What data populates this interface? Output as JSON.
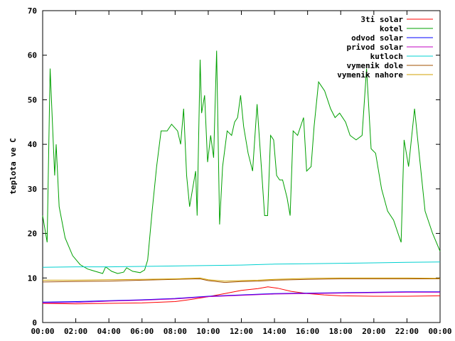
{
  "chart_data": {
    "type": "line",
    "title": "",
    "xlabel": "",
    "ylabel": "teplota ve C",
    "xlim": [
      0,
      24
    ],
    "ylim": [
      0,
      70
    ],
    "xticks": [
      "00:00",
      "02:00",
      "04:00",
      "06:00",
      "08:00",
      "10:00",
      "12:00",
      "14:00",
      "16:00",
      "18:00",
      "20:00",
      "22:00",
      "00:00"
    ],
    "yticks": [
      "0",
      "10",
      "20",
      "30",
      "40",
      "50",
      "60",
      "70"
    ],
    "grid": false,
    "legend_position": "top-right",
    "series": [
      {
        "name": "3ti solar",
        "color": "#ff0000",
        "points": [
          [
            0,
            4.3
          ],
          [
            2,
            4.2
          ],
          [
            4,
            4.3
          ],
          [
            6,
            4.4
          ],
          [
            8,
            4.7
          ],
          [
            9,
            5.2
          ],
          [
            10,
            5.8
          ],
          [
            11,
            6.5
          ],
          [
            12,
            7.2
          ],
          [
            13,
            7.6
          ],
          [
            13.6,
            8.0
          ],
          [
            14.2,
            7.7
          ],
          [
            15,
            7.0
          ],
          [
            16,
            6.5
          ],
          [
            17,
            6.2
          ],
          [
            18,
            6.0
          ],
          [
            20,
            5.9
          ],
          [
            22,
            5.9
          ],
          [
            24,
            6.0
          ]
        ]
      },
      {
        "name": "kotel",
        "color": "#00a000",
        "points": [
          [
            0,
            24
          ],
          [
            0.3,
            18
          ],
          [
            0.5,
            57
          ],
          [
            0.8,
            33
          ],
          [
            0.9,
            40
          ],
          [
            1.1,
            26
          ],
          [
            1.5,
            19
          ],
          [
            2,
            15
          ],
          [
            2.5,
            13
          ],
          [
            3,
            12
          ],
          [
            3.5,
            11.5
          ],
          [
            4,
            11
          ],
          [
            4.2,
            12.5
          ],
          [
            4.6,
            11.5
          ],
          [
            5,
            11
          ],
          [
            5.4,
            11.3
          ],
          [
            5.6,
            12.3
          ],
          [
            6,
            11.5
          ],
          [
            6.5,
            11.2
          ],
          [
            6.8,
            11.8
          ],
          [
            7,
            14
          ],
          [
            7.3,
            25
          ],
          [
            7.6,
            35
          ],
          [
            7.9,
            43
          ],
          [
            8.3,
            43
          ],
          [
            8.6,
            44.5
          ],
          [
            9,
            43
          ],
          [
            9.2,
            40
          ],
          [
            9.4,
            48
          ],
          [
            9.6,
            33
          ],
          [
            9.8,
            26
          ],
          [
            10,
            30
          ],
          [
            10.2,
            34
          ],
          [
            10.3,
            24
          ],
          [
            10.5,
            59
          ],
          [
            10.6,
            47
          ],
          [
            10.8,
            51
          ],
          [
            11,
            36
          ],
          [
            11.2,
            42
          ],
          [
            11.4,
            37
          ],
          [
            11.6,
            61
          ],
          [
            11.8,
            22
          ],
          [
            12,
            35
          ],
          [
            12.3,
            43
          ],
          [
            12.6,
            42
          ],
          [
            12.8,
            45
          ],
          [
            13,
            46
          ],
          [
            13.2,
            51
          ],
          [
            13.4,
            44
          ],
          [
            13.7,
            38
          ],
          [
            14,
            34
          ],
          [
            14.3,
            49
          ],
          [
            14.6,
            34
          ],
          [
            14.8,
            24
          ],
          [
            15,
            24
          ],
          [
            15.2,
            42
          ],
          [
            15.4,
            41
          ],
          [
            15.6,
            33
          ],
          [
            15.8,
            32
          ],
          [
            16,
            32
          ],
          [
            16.3,
            28
          ],
          [
            16.5,
            24
          ],
          [
            16.7,
            43
          ],
          [
            17,
            42
          ],
          [
            17.4,
            46
          ],
          [
            17.6,
            34
          ],
          [
            17.9,
            35
          ],
          [
            18.1,
            44
          ],
          [
            18.4,
            54
          ],
          [
            18.8,
            52
          ],
          [
            19.2,
            48
          ],
          [
            19.5,
            46
          ],
          [
            19.8,
            47
          ],
          [
            20.2,
            45
          ],
          [
            20.5,
            42
          ],
          [
            20.9,
            41
          ],
          [
            21.3,
            42
          ],
          [
            21.6,
            57
          ],
          [
            21.9,
            39
          ],
          [
            22.2,
            38
          ],
          [
            22.6,
            30
          ],
          [
            23,
            25
          ],
          [
            23.4,
            23
          ],
          [
            23.7,
            20
          ],
          [
            23.9,
            18
          ],
          [
            24.1,
            41
          ],
          [
            24.4,
            35
          ],
          [
            24.8,
            48
          ],
          [
            25.1,
            38
          ],
          [
            25.5,
            25
          ],
          [
            26,
            20
          ],
          [
            26.5,
            16
          ]
        ]
      },
      {
        "name": "odvod solar",
        "color": "#0000ff",
        "points": [
          [
            0,
            4.6
          ],
          [
            2,
            4.7
          ],
          [
            4,
            4.9
          ],
          [
            6,
            5.1
          ],
          [
            8,
            5.4
          ],
          [
            10,
            5.9
          ],
          [
            12,
            6.2
          ],
          [
            14,
            6.5
          ],
          [
            16,
            6.6
          ],
          [
            18,
            6.7
          ],
          [
            20,
            6.8
          ],
          [
            22,
            6.9
          ],
          [
            24,
            6.9
          ]
        ]
      },
      {
        "name": "privod solar",
        "color": "#c000c0",
        "points": [
          [
            0,
            4.4
          ],
          [
            2,
            4.5
          ],
          [
            4,
            4.8
          ],
          [
            6,
            5.0
          ],
          [
            8,
            5.3
          ],
          [
            10,
            5.8
          ],
          [
            12,
            6.1
          ],
          [
            14,
            6.4
          ],
          [
            16,
            6.5
          ],
          [
            18,
            6.6
          ],
          [
            20,
            6.7
          ],
          [
            22,
            6.8
          ],
          [
            24,
            6.8
          ]
        ]
      },
      {
        "name": "kutloch",
        "color": "#00d0d0",
        "points": [
          [
            0,
            12.4
          ],
          [
            2,
            12.5
          ],
          [
            4,
            12.5
          ],
          [
            6,
            12.6
          ],
          [
            8,
            12.7
          ],
          [
            10,
            12.8
          ],
          [
            12,
            12.9
          ],
          [
            14,
            13.1
          ],
          [
            16,
            13.2
          ],
          [
            18,
            13.3
          ],
          [
            20,
            13.4
          ],
          [
            22,
            13.5
          ],
          [
            24,
            13.6
          ]
        ]
      },
      {
        "name": "vymenik dole",
        "color": "#a05000",
        "points": [
          [
            0,
            9.1
          ],
          [
            2,
            9.2
          ],
          [
            4,
            9.3
          ],
          [
            6,
            9.5
          ],
          [
            8,
            9.7
          ],
          [
            9.5,
            9.8
          ],
          [
            10,
            9.4
          ],
          [
            11,
            9.0
          ],
          [
            12,
            9.2
          ],
          [
            13,
            9.3
          ],
          [
            14,
            9.5
          ],
          [
            16,
            9.7
          ],
          [
            18,
            9.8
          ],
          [
            20,
            9.8
          ],
          [
            22,
            9.8
          ],
          [
            24,
            9.8
          ]
        ]
      },
      {
        "name": "vymenik nahore",
        "color": "#d0a000",
        "points": [
          [
            0,
            9.5
          ],
          [
            2,
            9.5
          ],
          [
            4,
            9.6
          ],
          [
            6,
            9.7
          ],
          [
            8,
            9.8
          ],
          [
            9.5,
            10.0
          ],
          [
            10,
            9.6
          ],
          [
            11,
            9.3
          ],
          [
            12,
            9.4
          ],
          [
            13,
            9.5
          ],
          [
            14,
            9.7
          ],
          [
            16,
            9.9
          ],
          [
            18,
            10.0
          ],
          [
            20,
            10.0
          ],
          [
            22,
            10.0
          ],
          [
            24,
            9.9
          ]
        ]
      }
    ]
  }
}
